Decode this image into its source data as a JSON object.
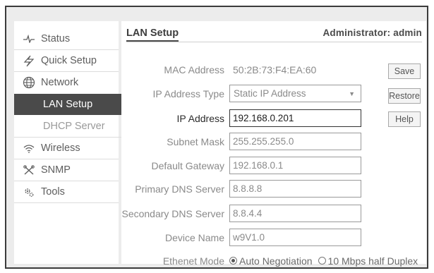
{
  "sidebar": {
    "items": [
      {
        "label": "Status",
        "icon": "pulse-icon"
      },
      {
        "label": "Quick Setup",
        "icon": "lightning-icon"
      },
      {
        "label": "Network",
        "icon": "globe-icon"
      },
      {
        "label": "LAN Setup"
      },
      {
        "label": "DHCP Server"
      },
      {
        "label": "Wireless",
        "icon": "wifi-icon"
      },
      {
        "label": "SNMP",
        "icon": "tools-cross-icon"
      },
      {
        "label": "Tools",
        "icon": "gears-icon"
      }
    ],
    "active": "LAN Setup"
  },
  "header": {
    "title": "LAN Setup",
    "user": "Administrator: admin"
  },
  "form": {
    "mac_label": "MAC Address",
    "mac_value": "50:2B:73:F4:EA:60",
    "ip_type_label": "IP Address Type",
    "ip_type_value": "Static IP Address",
    "ip_label": "IP Address",
    "ip_value": "192.168.0.201",
    "mask_label": "Subnet Mask",
    "mask_value": "255.255.255.0",
    "gateway_label": "Default Gateway",
    "gateway_value": "192.168.0.1",
    "dns1_label": "Primary DNS Server",
    "dns1_value": "8.8.8.8",
    "dns2_label": "Secondary DNS Server",
    "dns2_value": "8.8.4.4",
    "device_label": "Device Name",
    "device_value": "w9V1.0",
    "mode_label": "Ethenet Mode",
    "mode_option_1": "Auto Negotiation",
    "mode_option_2": "10 Mbps half Duplex"
  },
  "buttons": {
    "save": "Save",
    "restore": "Restore",
    "help": "Help"
  }
}
